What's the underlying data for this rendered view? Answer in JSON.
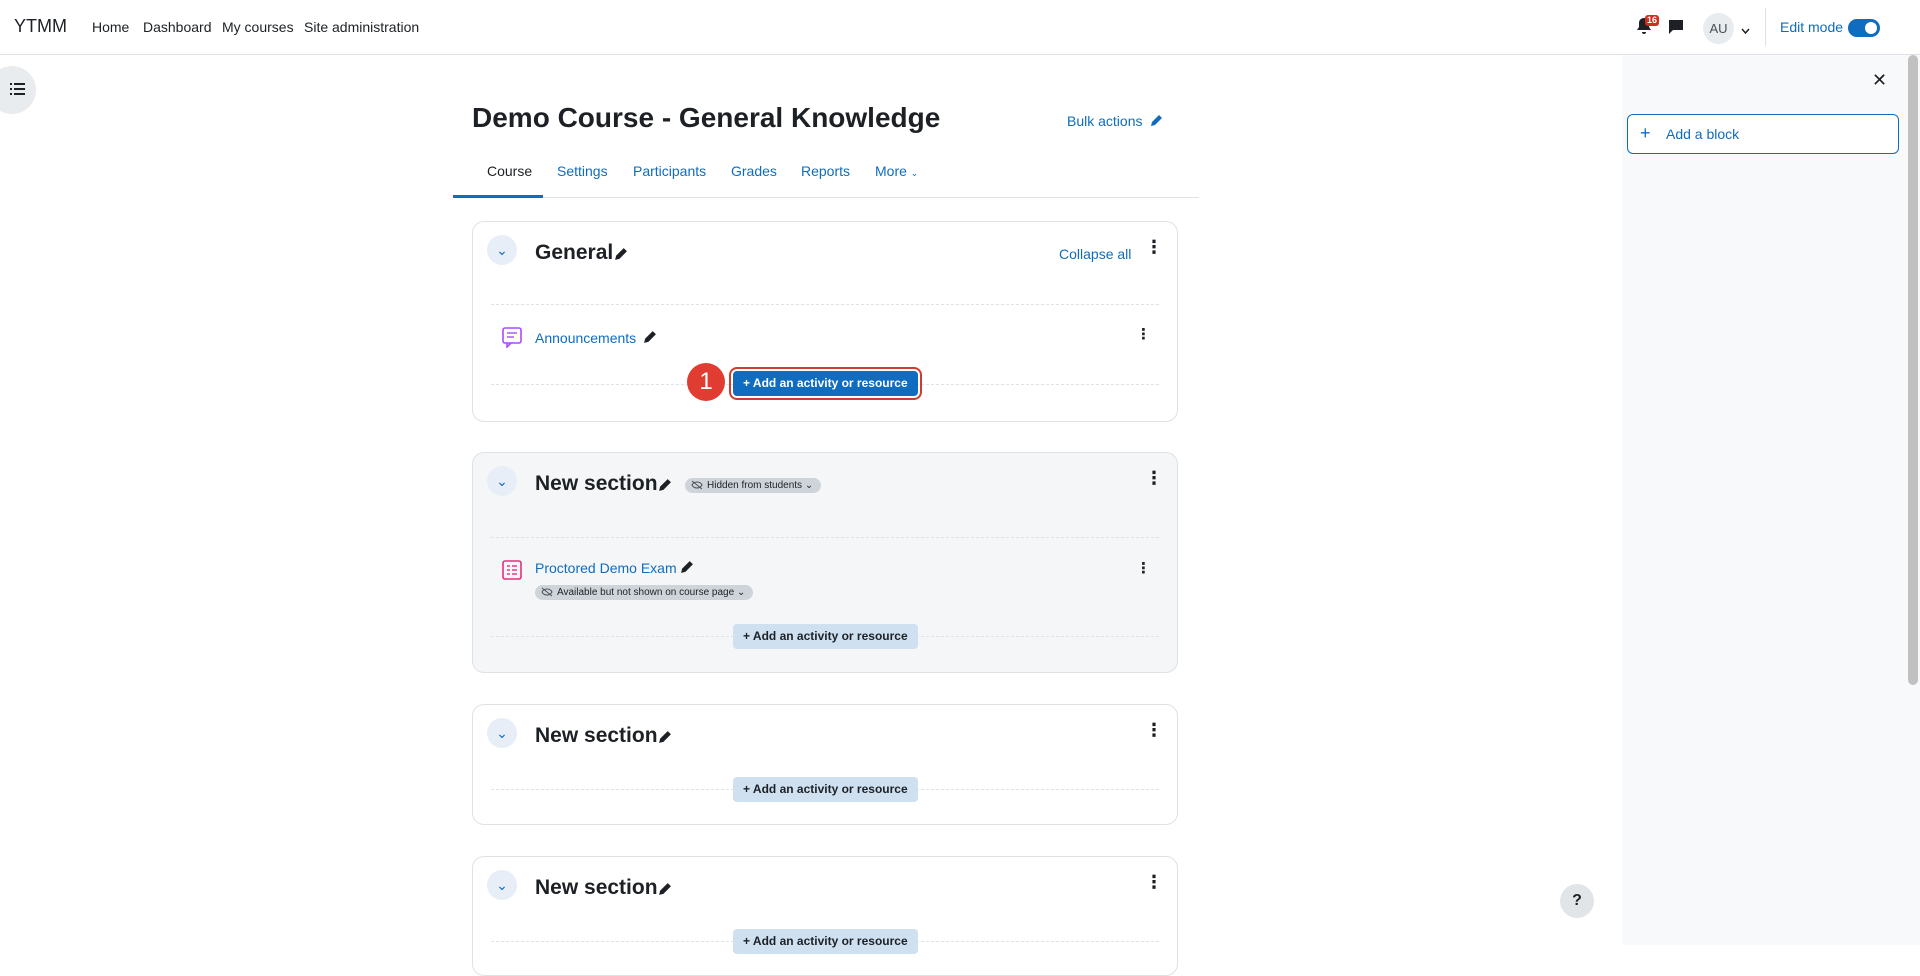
{
  "nav": {
    "brand": "YTMM",
    "links": [
      "Home",
      "Dashboard",
      "My courses",
      "Site administration"
    ],
    "notification_count": "16",
    "avatar_initials": "AU",
    "edit_mode_label": "Edit mode"
  },
  "page": {
    "title": "Demo Course - General Knowledge",
    "bulk_actions": "Bulk actions"
  },
  "tabs": [
    "Course",
    "Settings",
    "Participants",
    "Grades",
    "Reports",
    "More"
  ],
  "block_drawer": {
    "add_block": "Add a block"
  },
  "sections": [
    {
      "title": "General",
      "collapse_all": "Collapse all",
      "activities": [
        {
          "name": "Announcements"
        }
      ],
      "add_label": "Add an activity or resource"
    },
    {
      "title": "New section",
      "badge": "Hidden from students",
      "activities": [
        {
          "name": "Proctored Demo Exam",
          "badge": "Available but not shown on course page"
        }
      ],
      "add_label": "Add an activity or resource"
    },
    {
      "title": "New section",
      "add_label": "Add an activity or resource"
    },
    {
      "title": "New section",
      "add_label": "Add an activity or resource"
    }
  ],
  "step_marker": "1",
  "help_label": "?"
}
